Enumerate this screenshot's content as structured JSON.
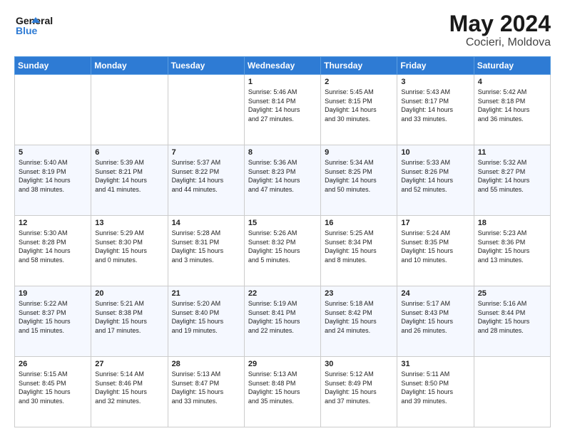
{
  "header": {
    "logo_line1": "General",
    "logo_line2": "Blue",
    "month_year": "May 2024",
    "location": "Cocieri, Moldova"
  },
  "days_of_week": [
    "Sunday",
    "Monday",
    "Tuesday",
    "Wednesday",
    "Thursday",
    "Friday",
    "Saturday"
  ],
  "weeks": [
    [
      {
        "day": "",
        "info": ""
      },
      {
        "day": "",
        "info": ""
      },
      {
        "day": "",
        "info": ""
      },
      {
        "day": "1",
        "info": "Sunrise: 5:46 AM\nSunset: 8:14 PM\nDaylight: 14 hours\nand 27 minutes."
      },
      {
        "day": "2",
        "info": "Sunrise: 5:45 AM\nSunset: 8:15 PM\nDaylight: 14 hours\nand 30 minutes."
      },
      {
        "day": "3",
        "info": "Sunrise: 5:43 AM\nSunset: 8:17 PM\nDaylight: 14 hours\nand 33 minutes."
      },
      {
        "day": "4",
        "info": "Sunrise: 5:42 AM\nSunset: 8:18 PM\nDaylight: 14 hours\nand 36 minutes."
      }
    ],
    [
      {
        "day": "5",
        "info": "Sunrise: 5:40 AM\nSunset: 8:19 PM\nDaylight: 14 hours\nand 38 minutes."
      },
      {
        "day": "6",
        "info": "Sunrise: 5:39 AM\nSunset: 8:21 PM\nDaylight: 14 hours\nand 41 minutes."
      },
      {
        "day": "7",
        "info": "Sunrise: 5:37 AM\nSunset: 8:22 PM\nDaylight: 14 hours\nand 44 minutes."
      },
      {
        "day": "8",
        "info": "Sunrise: 5:36 AM\nSunset: 8:23 PM\nDaylight: 14 hours\nand 47 minutes."
      },
      {
        "day": "9",
        "info": "Sunrise: 5:34 AM\nSunset: 8:25 PM\nDaylight: 14 hours\nand 50 minutes."
      },
      {
        "day": "10",
        "info": "Sunrise: 5:33 AM\nSunset: 8:26 PM\nDaylight: 14 hours\nand 52 minutes."
      },
      {
        "day": "11",
        "info": "Sunrise: 5:32 AM\nSunset: 8:27 PM\nDaylight: 14 hours\nand 55 minutes."
      }
    ],
    [
      {
        "day": "12",
        "info": "Sunrise: 5:30 AM\nSunset: 8:28 PM\nDaylight: 14 hours\nand 58 minutes."
      },
      {
        "day": "13",
        "info": "Sunrise: 5:29 AM\nSunset: 8:30 PM\nDaylight: 15 hours\nand 0 minutes."
      },
      {
        "day": "14",
        "info": "Sunrise: 5:28 AM\nSunset: 8:31 PM\nDaylight: 15 hours\nand 3 minutes."
      },
      {
        "day": "15",
        "info": "Sunrise: 5:26 AM\nSunset: 8:32 PM\nDaylight: 15 hours\nand 5 minutes."
      },
      {
        "day": "16",
        "info": "Sunrise: 5:25 AM\nSunset: 8:34 PM\nDaylight: 15 hours\nand 8 minutes."
      },
      {
        "day": "17",
        "info": "Sunrise: 5:24 AM\nSunset: 8:35 PM\nDaylight: 15 hours\nand 10 minutes."
      },
      {
        "day": "18",
        "info": "Sunrise: 5:23 AM\nSunset: 8:36 PM\nDaylight: 15 hours\nand 13 minutes."
      }
    ],
    [
      {
        "day": "19",
        "info": "Sunrise: 5:22 AM\nSunset: 8:37 PM\nDaylight: 15 hours\nand 15 minutes."
      },
      {
        "day": "20",
        "info": "Sunrise: 5:21 AM\nSunset: 8:38 PM\nDaylight: 15 hours\nand 17 minutes."
      },
      {
        "day": "21",
        "info": "Sunrise: 5:20 AM\nSunset: 8:40 PM\nDaylight: 15 hours\nand 19 minutes."
      },
      {
        "day": "22",
        "info": "Sunrise: 5:19 AM\nSunset: 8:41 PM\nDaylight: 15 hours\nand 22 minutes."
      },
      {
        "day": "23",
        "info": "Sunrise: 5:18 AM\nSunset: 8:42 PM\nDaylight: 15 hours\nand 24 minutes."
      },
      {
        "day": "24",
        "info": "Sunrise: 5:17 AM\nSunset: 8:43 PM\nDaylight: 15 hours\nand 26 minutes."
      },
      {
        "day": "25",
        "info": "Sunrise: 5:16 AM\nSunset: 8:44 PM\nDaylight: 15 hours\nand 28 minutes."
      }
    ],
    [
      {
        "day": "26",
        "info": "Sunrise: 5:15 AM\nSunset: 8:45 PM\nDaylight: 15 hours\nand 30 minutes."
      },
      {
        "day": "27",
        "info": "Sunrise: 5:14 AM\nSunset: 8:46 PM\nDaylight: 15 hours\nand 32 minutes."
      },
      {
        "day": "28",
        "info": "Sunrise: 5:13 AM\nSunset: 8:47 PM\nDaylight: 15 hours\nand 33 minutes."
      },
      {
        "day": "29",
        "info": "Sunrise: 5:13 AM\nSunset: 8:48 PM\nDaylight: 15 hours\nand 35 minutes."
      },
      {
        "day": "30",
        "info": "Sunrise: 5:12 AM\nSunset: 8:49 PM\nDaylight: 15 hours\nand 37 minutes."
      },
      {
        "day": "31",
        "info": "Sunrise: 5:11 AM\nSunset: 8:50 PM\nDaylight: 15 hours\nand 39 minutes."
      },
      {
        "day": "",
        "info": ""
      }
    ]
  ]
}
